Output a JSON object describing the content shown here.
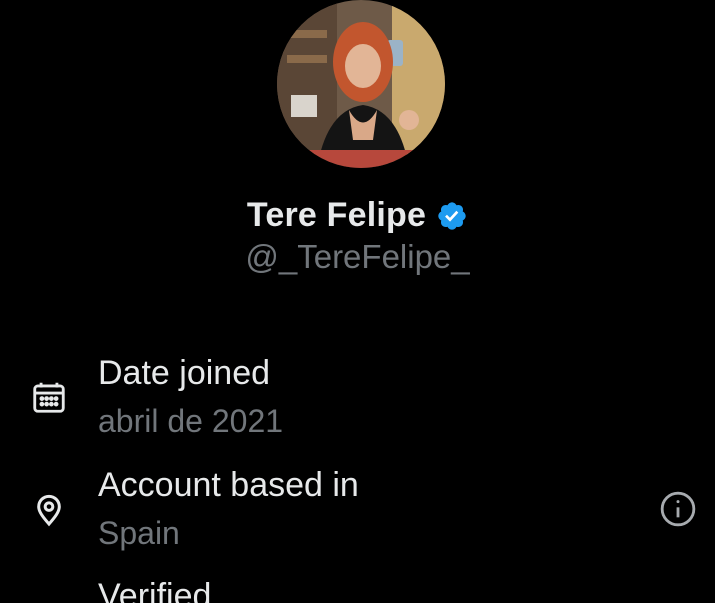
{
  "profile": {
    "display_name": "Tere Felipe",
    "handle": "@_TereFelipe_",
    "verified": true
  },
  "about": {
    "rows": [
      {
        "label": "Date joined",
        "value": "abril de 2021",
        "icon": "calendar-icon"
      },
      {
        "label": "Account based in",
        "value": "Spain",
        "icon": "location-pin-icon",
        "action_icon": "info-icon"
      },
      {
        "label": "Verified",
        "value": "",
        "icon": "verified-icon"
      }
    ]
  },
  "colors": {
    "background": "#000000",
    "primary_text": "#e7e9ea",
    "secondary_text": "#71767b",
    "verified_blue": "#1d9bf0"
  }
}
